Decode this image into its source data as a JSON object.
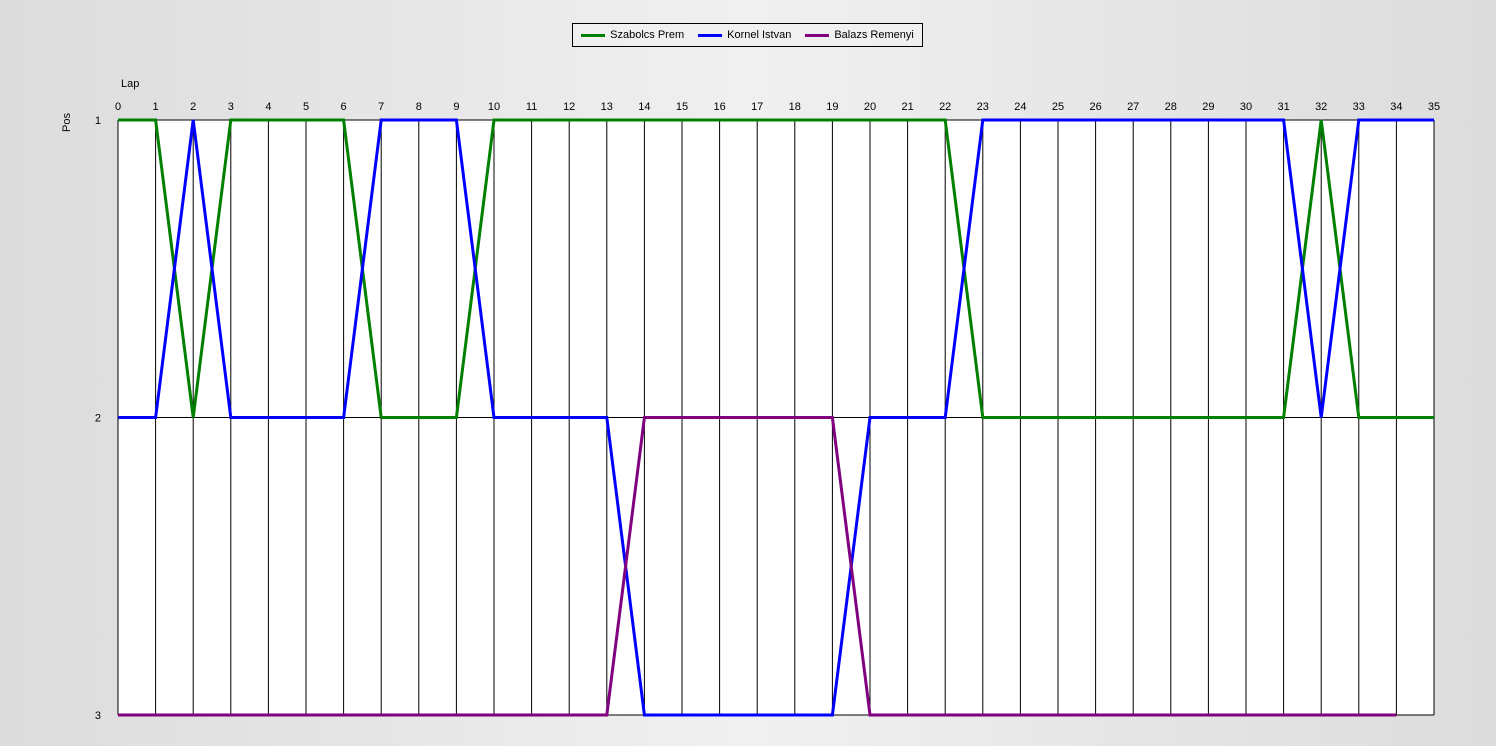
{
  "chart_data": {
    "type": "line",
    "xlabel": "Lap",
    "ylabel": "Pos",
    "xlim": [
      0,
      35
    ],
    "ylim": [
      1,
      3
    ],
    "y_ticks": [
      1,
      2,
      3
    ],
    "y_inverted": true,
    "grid": "vertical",
    "legend_position": "top-center",
    "series": [
      {
        "name": "Szabolcs Prem",
        "color": "#008000",
        "x": [
          0,
          1,
          2,
          3,
          4,
          5,
          6,
          7,
          8,
          9,
          10,
          11,
          12,
          13,
          14,
          15,
          16,
          17,
          18,
          19,
          20,
          21,
          22,
          23,
          24,
          25,
          26,
          27,
          28,
          29,
          30,
          31,
          32,
          33,
          34,
          35
        ],
        "values": [
          1,
          1,
          2,
          1,
          1,
          1,
          1,
          2,
          2,
          2,
          1,
          1,
          1,
          1,
          1,
          1,
          1,
          1,
          1,
          1,
          1,
          1,
          1,
          2,
          2,
          2,
          2,
          2,
          2,
          2,
          2,
          2,
          1,
          2,
          2,
          2
        ]
      },
      {
        "name": "Kornel Istvan",
        "color": "#0000ff",
        "x": [
          0,
          1,
          2,
          3,
          4,
          5,
          6,
          7,
          8,
          9,
          10,
          11,
          12,
          13,
          14,
          15,
          16,
          17,
          18,
          19,
          20,
          21,
          22,
          23,
          24,
          25,
          26,
          27,
          28,
          29,
          30,
          31,
          32,
          33,
          34,
          35
        ],
        "values": [
          2,
          2,
          1,
          2,
          2,
          2,
          2,
          1,
          1,
          1,
          2,
          2,
          2,
          2,
          3,
          3,
          3,
          3,
          3,
          3,
          2,
          2,
          2,
          1,
          1,
          1,
          1,
          1,
          1,
          1,
          1,
          1,
          2,
          1,
          1,
          1
        ]
      },
      {
        "name": "Balazs Remenyi",
        "color": "#800080",
        "x": [
          0,
          1,
          2,
          3,
          4,
          5,
          6,
          7,
          8,
          9,
          10,
          11,
          12,
          13,
          14,
          15,
          16,
          17,
          18,
          19,
          20,
          21,
          22,
          23,
          24,
          25,
          26,
          27,
          28,
          29,
          30,
          31,
          32,
          33,
          34
        ],
        "values": [
          3,
          3,
          3,
          3,
          3,
          3,
          3,
          3,
          3,
          3,
          3,
          3,
          3,
          3,
          2,
          2,
          2,
          2,
          2,
          2,
          3,
          3,
          3,
          3,
          3,
          3,
          3,
          3,
          3,
          3,
          3,
          3,
          3,
          3,
          3
        ]
      }
    ]
  }
}
